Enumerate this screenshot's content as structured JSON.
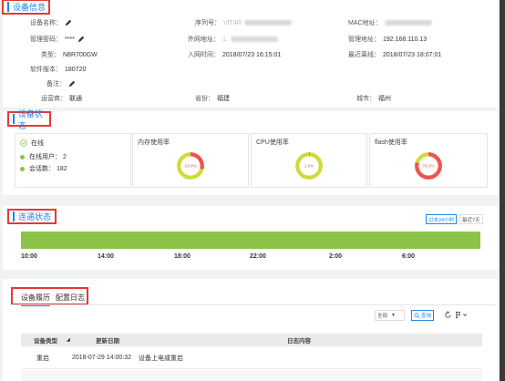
{
  "device_info": {
    "title": "设备信息",
    "device_name_label": "设备名称：",
    "serial_label": "序列号：",
    "serial_value": "VIT4R",
    "mac_label": "MAC地址：",
    "password_label": "管理密码：",
    "password_value": "****",
    "wan_label": "外网地址：",
    "wan_value": "1.",
    "mgmt_addr_label": "管理地址：",
    "mgmt_addr_value": "192.168.110.13",
    "type_label": "类型：",
    "type_value": "N8R700GW",
    "online_time_label": "入网时间：",
    "online_time_value": "2018/07/23 16:15:01",
    "last_offline_label": "最近离线：",
    "last_offline_value": "2018/07/23 18:07:01",
    "software_label": "软件版本：",
    "software_value": "180720",
    "remark_label": "备注：",
    "isp_label": "运营商：",
    "isp_value": "联通",
    "province_label": "省份：",
    "province_value": "福建",
    "city_label": "城市：",
    "city_value": "福州"
  },
  "device_status": {
    "title": "设备状态",
    "online_text": "在线",
    "online_users_label": "在线用户：",
    "online_users_value": "2",
    "sessions_label": "会话数：",
    "sessions_value": "182",
    "memory": {
      "title": "内存使用率",
      "percent": 29.0,
      "label": "29.0%"
    },
    "cpu": {
      "title": "CPU使用率",
      "percent": 1.0,
      "label": "1.0%"
    },
    "flash": {
      "title": "flash使用率",
      "percent": 79.0,
      "label": "79.0%"
    },
    "colors": {
      "used": "#ef5350",
      "free": "#cddc39"
    }
  },
  "connectivity": {
    "title": "连通状态",
    "btn_24h": "过去24小时",
    "btn_7d": "最近7天",
    "ticks": [
      "10:00",
      "14:00",
      "18:00",
      "22:00",
      "2:00",
      "6:00"
    ],
    "bar_color": "#8bc34a"
  },
  "history": {
    "tab_device": "设备履历",
    "tab_config": "配置日志",
    "filter_value": "全部",
    "query_label": "查询",
    "columns": {
      "type": "设备类型",
      "date": "更新日期",
      "content": "日志内容"
    },
    "rows": [
      {
        "type": "重启",
        "date": "2018-07-29 14:00:32",
        "content": "设备上电或重启"
      }
    ]
  }
}
